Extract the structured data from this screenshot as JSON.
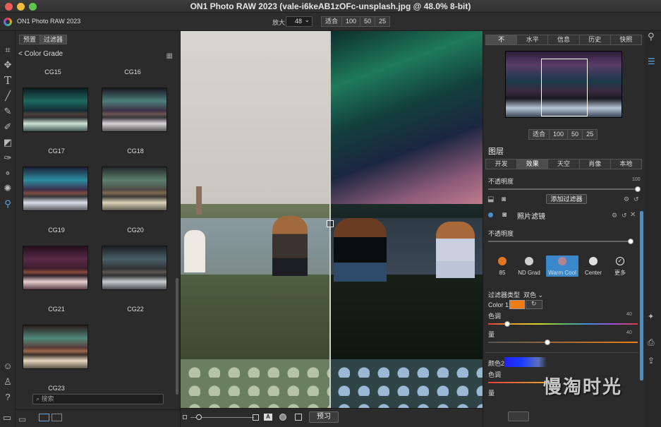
{
  "window": {
    "title": "ON1 Photo RAW 2023 (vale-i6keAB1zOFc-unsplash.jpg @ 48.0% 8-bit)"
  },
  "toolbar": {
    "app_name": "ON1 Photo RAW 2023",
    "zoom_label": "放大",
    "zoom_value": "48",
    "zoom_buttons": [
      "适合",
      "100",
      "50",
      "25"
    ]
  },
  "left_panel": {
    "tabs": [
      "预置",
      "过滤器"
    ],
    "active_tab": 1,
    "category": "Color Grade",
    "presets": [
      "CG15",
      "CG16",
      "CG17",
      "CG18",
      "CG19",
      "CG20",
      "CG21",
      "CG22",
      "CG23"
    ],
    "search_placeholder": "搜索"
  },
  "canvas": {
    "preview_label": "预习"
  },
  "right_panel": {
    "tabs": [
      "不",
      "水平",
      "信息",
      "历史",
      "快照"
    ],
    "active_tab": 0,
    "nav_buttons": [
      "适合",
      "100",
      "50",
      "25"
    ],
    "layers_title": "图层",
    "effect_tabs": [
      "开发",
      "效果",
      "天空",
      "肖像",
      "本地"
    ],
    "active_effect_tab": 1,
    "opacity_label": "不透明度",
    "opacity_value": "100",
    "add_filter_label": "添加过滤器",
    "filter_name": "照片滤镜",
    "filter_opacity_label": "不透明度",
    "filter_presets": [
      {
        "label": "85",
        "color": "#e3761f"
      },
      {
        "label": "ND Grad",
        "color": "#cfcfcf"
      },
      {
        "label": "Warm Cool",
        "color": "#b08790"
      },
      {
        "label": "Center",
        "color": "#e0e0e0"
      },
      {
        "label": "更多",
        "color": ""
      }
    ],
    "active_preset": 2,
    "filter_type_label": "过滤器类型",
    "filter_type_value": "双色",
    "color1_label": "Color 1:",
    "color1": "#f07d13",
    "hue_label": "色调",
    "hue_value": "40",
    "amount_label": "量",
    "amount_value": "40",
    "color2_label": "颜色2",
    "hue2_label": "色调",
    "amount2_label": "量"
  },
  "watermark": "慢淘时光",
  "colors": {
    "accent": "#4790c9"
  }
}
